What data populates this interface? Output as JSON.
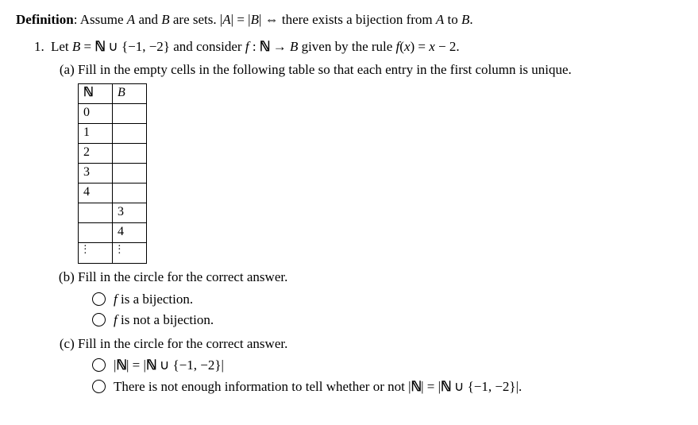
{
  "definition": {
    "label": "Definition",
    "text": ": Assume A and B are sets. |A| = |B| ⇔ there exists a bijection from A to B."
  },
  "problem": {
    "intro": "Let B = ℕ ∪ {−1, −2} and consider f : ℕ → B given by the rule f(x) = x − 2.",
    "a": {
      "text": "Fill in the empty cells in the following table so that each entry in the first column is unique.",
      "table": {
        "headers": [
          "ℕ",
          "B"
        ],
        "rows": [
          [
            "0",
            ""
          ],
          [
            "1",
            ""
          ],
          [
            "2",
            ""
          ],
          [
            "3",
            ""
          ],
          [
            "4",
            ""
          ],
          [
            "",
            "3"
          ],
          [
            "",
            "4"
          ],
          [
            "⋮",
            "⋮"
          ]
        ]
      }
    },
    "b": {
      "text": "Fill in the circle for the correct answer.",
      "options": [
        "f is a bijection.",
        "f is not a bijection."
      ]
    },
    "c": {
      "text": "Fill in the circle for the correct answer.",
      "options": [
        "|ℕ| = |ℕ ∪ {−1, −2}|",
        "There is not enough information to tell whether or not |ℕ| = |ℕ ∪ {−1, −2}|."
      ]
    }
  }
}
